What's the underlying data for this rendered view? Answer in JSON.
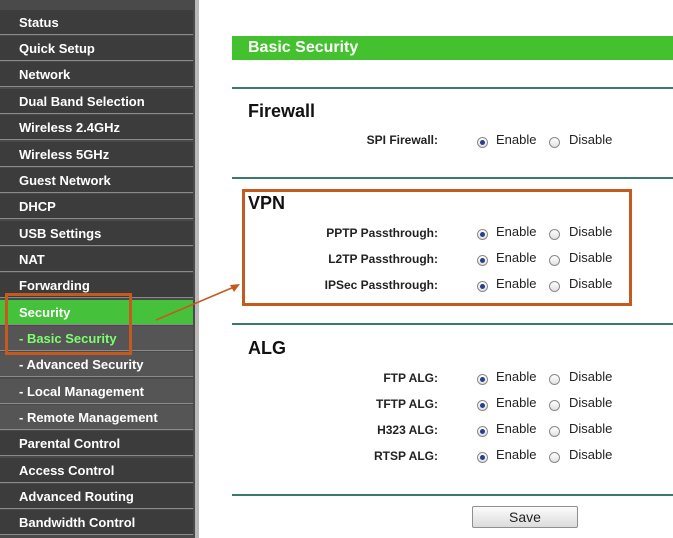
{
  "sidebar": {
    "items": [
      {
        "label": "Status"
      },
      {
        "label": "Quick Setup"
      },
      {
        "label": "Network"
      },
      {
        "label": "Dual Band Selection"
      },
      {
        "label": "Wireless 2.4GHz"
      },
      {
        "label": "Wireless 5GHz"
      },
      {
        "label": "Guest Network"
      },
      {
        "label": "DHCP"
      },
      {
        "label": "USB Settings"
      },
      {
        "label": "NAT"
      },
      {
        "label": "Forwarding"
      },
      {
        "label": "Security"
      },
      {
        "label": "- Basic Security"
      },
      {
        "label": "- Advanced Security"
      },
      {
        "label": "- Local Management"
      },
      {
        "label": "- Remote Management"
      },
      {
        "label": "Parental Control"
      },
      {
        "label": "Access Control"
      },
      {
        "label": "Advanced Routing"
      },
      {
        "label": "Bandwidth Control"
      }
    ]
  },
  "page": {
    "title": "Basic Security"
  },
  "option_labels": {
    "enable": "Enable",
    "disable": "Disable"
  },
  "firewall": {
    "title": "Firewall",
    "rows": [
      {
        "label": "SPI Firewall:",
        "value": "Enable"
      }
    ]
  },
  "vpn": {
    "title": "VPN",
    "rows": [
      {
        "label": "PPTP Passthrough:",
        "value": "Enable"
      },
      {
        "label": "L2TP Passthrough:",
        "value": "Enable"
      },
      {
        "label": "IPSec Passthrough:",
        "value": "Enable"
      }
    ]
  },
  "alg": {
    "title": "ALG",
    "rows": [
      {
        "label": "FTP ALG:",
        "value": "Enable"
      },
      {
        "label": "TFTP ALG:",
        "value": "Enable"
      },
      {
        "label": "H323 ALG:",
        "value": "Enable"
      },
      {
        "label": "RTSP ALG:",
        "value": "Enable"
      }
    ]
  },
  "save_label": "Save",
  "colors": {
    "accent_green": "#44c12f",
    "highlight_orange": "#c65a1e"
  }
}
